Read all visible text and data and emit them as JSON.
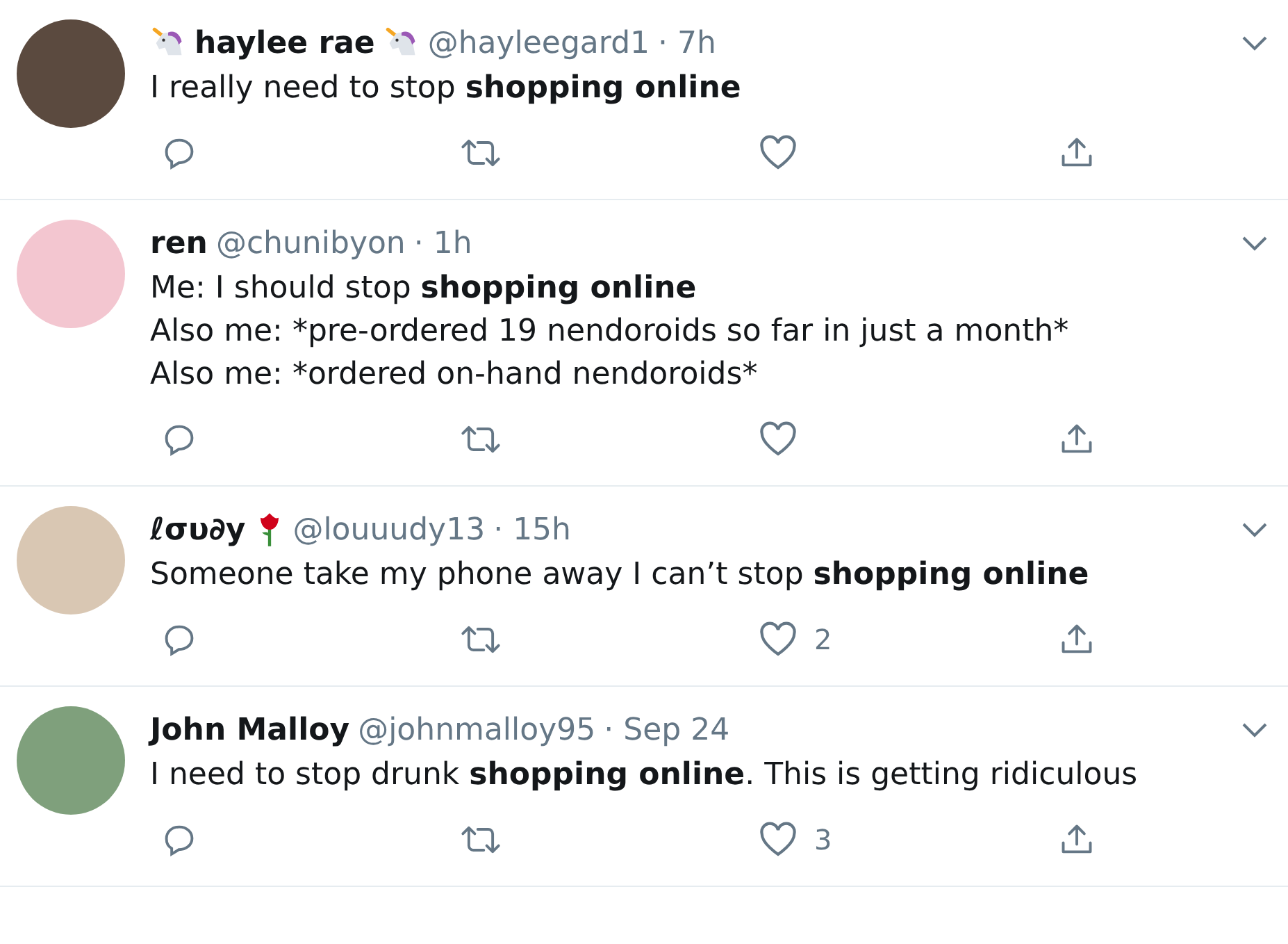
{
  "tweets": [
    {
      "name": "haylee rae",
      "icons_before_name": [
        {
          "kind": "unicorn"
        }
      ],
      "icons_after_name": [
        {
          "kind": "unicorn"
        }
      ],
      "handle": "@hayleegard1",
      "time": "· 7h",
      "lines": [
        {
          "kind": "marked",
          "text": "I really need to stop **shopping online**"
        }
      ]
    },
    {
      "name": "ren",
      "handle": "@chunibyon",
      "time": "· 1h",
      "lines": [
        {
          "kind": "marked",
          "text": "Me: I should stop **shopping online**"
        },
        {
          "kind": "plain",
          "text": "Also me: *pre-ordered 19 nendoroids so far in just a month*"
        },
        {
          "kind": "plain",
          "text": "Also me: *ordered on-hand nendoroids*"
        }
      ]
    },
    {
      "name": "ℓσυ∂у",
      "icons_after_name": [
        {
          "kind": "rose"
        }
      ],
      "handle": "@louuudy13",
      "time": "· 15h",
      "lines": [
        {
          "kind": "marked",
          "text": "Someone take my phone away I can’t stop **shopping online**"
        }
      ],
      "counts": {
        "like": "2"
      }
    },
    {
      "name": "John Malloy",
      "handle": "@johnmalloy95",
      "time": "· Sep 24",
      "lines": [
        {
          "kind": "marked",
          "text": "I need to stop drunk **shopping online**. This is getting ridiculous"
        }
      ],
      "counts": {
        "like": "3"
      }
    }
  ]
}
